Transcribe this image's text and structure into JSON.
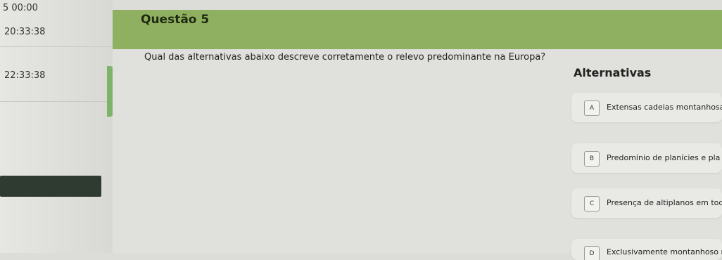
{
  "sidebar": {
    "time1": "5 00:00",
    "time2": "20:33:38",
    "time3": "22:33:38"
  },
  "question": {
    "title": "Questão 5",
    "text": "Qual das alternativas abaixo descreve corretamente o relevo predominante na Europa?"
  },
  "alternatives": {
    "title": "Alternativas",
    "options": [
      {
        "letter": "A",
        "text": "Extensas cadeias montanhosa"
      },
      {
        "letter": "B",
        "text": "Predomínio de planícies e pla"
      },
      {
        "letter": "C",
        "text": "Presença de altiplanos em tod"
      },
      {
        "letter": "D",
        "text": "Exclusivamente montanhoso n"
      }
    ]
  },
  "colors": {
    "header": "#8fb061",
    "accent": "#7fb36a"
  }
}
